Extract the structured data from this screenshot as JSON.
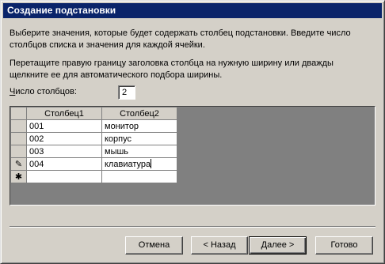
{
  "window": {
    "title": "Создание подстановки"
  },
  "instructions": {
    "line1": "Выберите значения, которые будет содержать столбец подстановки. Введите число столбцов списка и значения для каждой ячейки.",
    "line2": "Перетащите правую границу заголовка столбца на нужную ширину или дважды щелкните ее для автоматического подбора ширины."
  },
  "columns_count": {
    "label": "Число столбцов:",
    "value": "2"
  },
  "grid": {
    "headers": [
      "Столбец1",
      "Столбец2"
    ],
    "rows": [
      [
        "001",
        "монитор"
      ],
      [
        "002",
        "корпус"
      ],
      [
        "003",
        "мышь"
      ],
      [
        "004",
        "клавиатура"
      ]
    ],
    "new_row_marker": "✱",
    "edit_marker": "✎"
  },
  "buttons": {
    "cancel": "Отмена",
    "back": "< Назад",
    "next": "Далее >",
    "finish": "Готово"
  }
}
